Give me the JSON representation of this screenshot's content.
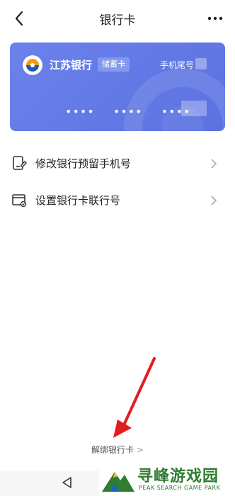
{
  "header": {
    "title": "银行卡",
    "back_icon": "chevron-left-icon",
    "more_icon": "more-dots-icon"
  },
  "card": {
    "bank_name": "江苏银行",
    "card_type": "储蓄卡",
    "phone_label": "手机尾号",
    "number_groups": [
      "••••",
      "••••",
      "••••"
    ],
    "colors": {
      "card_bg": "#6b82ec"
    }
  },
  "menu": {
    "items": [
      {
        "label": "修改银行预留手机号",
        "icon": "phone-edit-icon"
      },
      {
        "label": "设置银行卡联行号",
        "icon": "card-settings-icon"
      }
    ]
  },
  "footer": {
    "unbind_label": "解绑银行卡",
    "unbind_arrow": ">"
  },
  "watermark": {
    "title": "寻峰游戏园",
    "subtitle": "PEAK SEARCH GAME PARK"
  }
}
